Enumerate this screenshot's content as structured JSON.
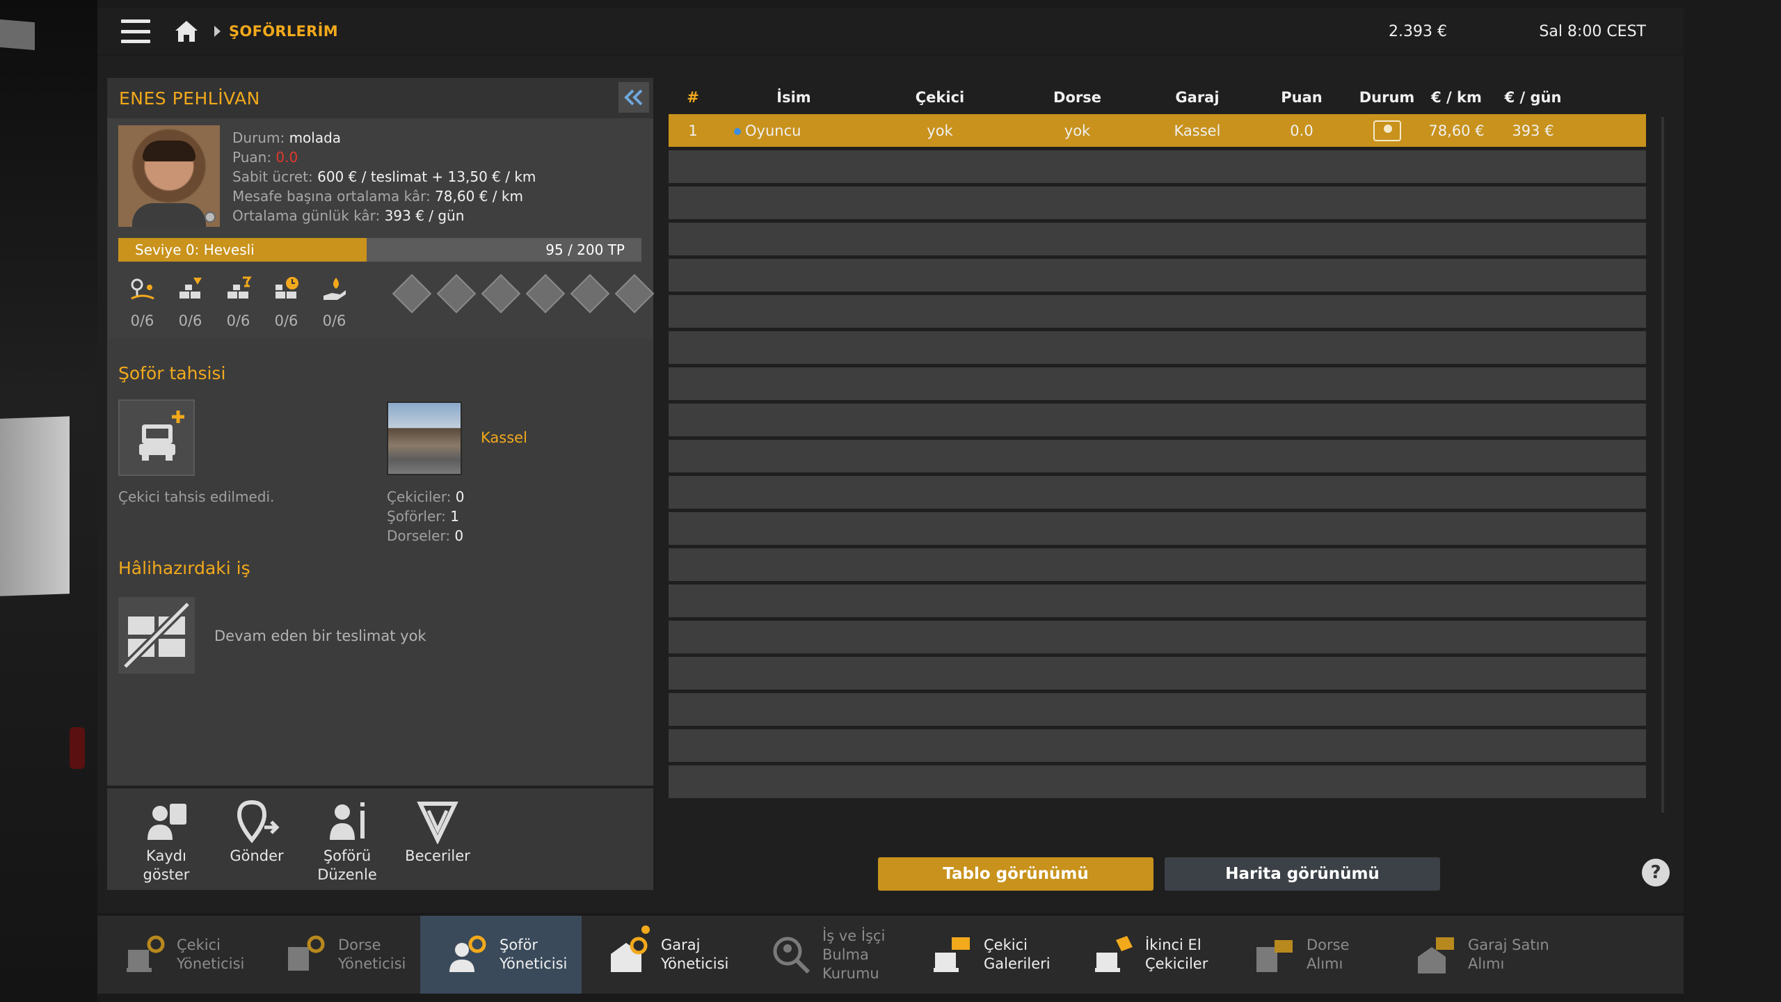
{
  "topbar": {
    "breadcrumb": "ŞOFÖRLERİM",
    "money": "2.393 €",
    "clock": "Sal 8:00 CEST"
  },
  "driver": {
    "name": "ENES PEHLİVAN",
    "status_label": "Durum:",
    "status_value": "molada",
    "rating_label": "Puan:",
    "rating_value": "0.0",
    "salary_label": "Sabit ücret:",
    "salary_value": "600 € / teslimat + 13,50 € / km",
    "profit_km_label": "Mesafe başına ortalama kâr:",
    "profit_km_value": "78,60 € / km",
    "profit_day_label": "Ortalama günlük kâr:",
    "profit_day_value": "393 € / gün",
    "level_label": "Seviye 0: Hevesli",
    "level_tp": "95 / 200 TP",
    "level_progress": 0.475,
    "skills": [
      "0/6",
      "0/6",
      "0/6",
      "0/6",
      "0/6"
    ]
  },
  "assignment": {
    "title": "Şoför tahsisi",
    "truck_text": "Çekici tahsis edilmedi.",
    "garage_name": "Kassel",
    "trucks_label": "Çekiciler:",
    "trucks_value": "0",
    "drivers_label": "Şoförler:",
    "drivers_value": "1",
    "trailers_label": "Dorseler:",
    "trailers_value": "0"
  },
  "current_job": {
    "title": "Hâlihazırdaki iş",
    "text": "Devam eden bir teslimat yok"
  },
  "actions": {
    "show_record_1": "Kaydı",
    "show_record_2": "göster",
    "send": "Gönder",
    "edit_1": "Şoförü",
    "edit_2": "Düzenle",
    "skills": "Beceriler"
  },
  "table": {
    "headers": [
      "#",
      "İsim",
      "Çekici",
      "Dorse",
      "Garaj",
      "Puan",
      "Durum",
      "€ / km",
      "€ / gün"
    ],
    "rows": [
      {
        "num": "1",
        "name": "Oyuncu",
        "truck": "yok",
        "trailer": "yok",
        "garage": "Kassel",
        "rating": "0.0",
        "per_km": "78,60 €",
        "per_day": "393 €"
      }
    ]
  },
  "view_buttons": {
    "table": "Tablo görünümü",
    "map": "Harita görünümü"
  },
  "help": "?",
  "bottom_nav": {
    "truck_manager_1": "Çekici",
    "truck_manager_2": "Yöneticisi",
    "trailer_manager_1": "Dorse",
    "trailer_manager_2": "Yöneticisi",
    "driver_manager_1": "Şoför",
    "driver_manager_2": "Yöneticisi",
    "garage_manager_1": "Garaj",
    "garage_manager_2": "Yöneticisi",
    "recruit_1": "İş ve İşçi",
    "recruit_2": "Bulma",
    "recruit_3": "Kurumu",
    "truck_dealers_1": "Çekici",
    "truck_dealers_2": "Galerileri",
    "used_trucks_1": "İkinci El",
    "used_trucks_2": "Çekiciler",
    "trailer_buy": "Dorse Alımı",
    "garage_buy_1": "Garaj Satın",
    "garage_buy_2": "Alımı"
  },
  "colors": {
    "accent": "#f2a91c",
    "selected_row": "#c8921c",
    "rating_red": "#e0392b",
    "active_nav": "#3a4a5a"
  }
}
